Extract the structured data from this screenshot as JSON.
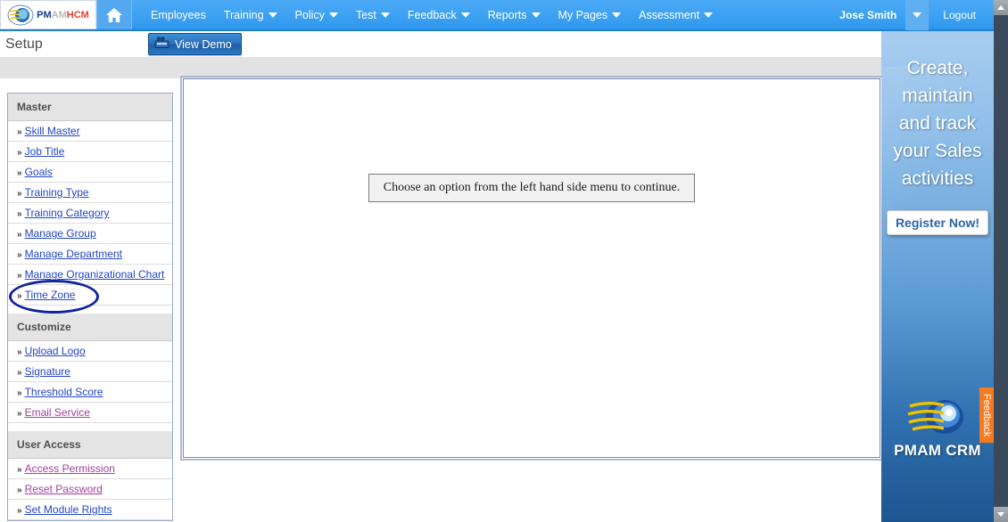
{
  "topnav": {
    "logo": {
      "pm": "PM",
      "am": "AM",
      "hcm": "HCM"
    },
    "home_title": "Home",
    "items": [
      {
        "label": "Employees",
        "has_caret": false
      },
      {
        "label": "Training",
        "has_caret": true
      },
      {
        "label": "Policy",
        "has_caret": true
      },
      {
        "label": "Test",
        "has_caret": true
      },
      {
        "label": "Feedback",
        "has_caret": true
      },
      {
        "label": "Reports",
        "has_caret": true
      },
      {
        "label": "My Pages",
        "has_caret": true
      },
      {
        "label": "Assessment",
        "has_caret": true
      }
    ],
    "username": "Jose Smith",
    "logout": "Logout"
  },
  "header": {
    "page_title": "Setup",
    "demo_button": "View Demo"
  },
  "sidebar": {
    "groups": [
      {
        "title": "Master",
        "items": [
          {
            "label": "Skill Master",
            "visited": false
          },
          {
            "label": "Job Title",
            "visited": false
          },
          {
            "label": "Goals",
            "visited": false
          },
          {
            "label": "Training Type",
            "visited": false
          },
          {
            "label": "Training Category",
            "visited": false
          },
          {
            "label": "Manage Group",
            "visited": false
          },
          {
            "label": "Manage Department",
            "visited": false
          },
          {
            "label": "Manage Organizational Chart",
            "visited": false
          },
          {
            "label": "Time Zone",
            "visited": false,
            "highlighted": true
          }
        ]
      },
      {
        "title": "Customize",
        "items": [
          {
            "label": "Upload Logo",
            "visited": false
          },
          {
            "label": "Signature",
            "visited": false
          },
          {
            "label": "Threshold Score",
            "visited": false
          },
          {
            "label": "Email Service",
            "visited": true
          }
        ]
      },
      {
        "title": "User Access",
        "items": [
          {
            "label": "Access Permission",
            "visited": true
          },
          {
            "label": "Reset Password",
            "visited": true
          },
          {
            "label": "Set Module Rights",
            "visited": false
          }
        ]
      }
    ],
    "bullet": "»"
  },
  "main": {
    "message": "Choose an option from the left hand side menu to continue."
  },
  "ad": {
    "headline": "Create, maintain and track your Sales activities",
    "button": "Register Now!",
    "brand": "PMAM CRM",
    "feedback_tab": "Feedback"
  },
  "colors": {
    "nav_blue": "#3ea2f2",
    "link_blue": "#2346c8",
    "link_visited": "#a43fa0",
    "highlight_ellipse": "#10239e",
    "feedback_orange": "#f47b20",
    "grey_bar": "#e2e2e2"
  }
}
